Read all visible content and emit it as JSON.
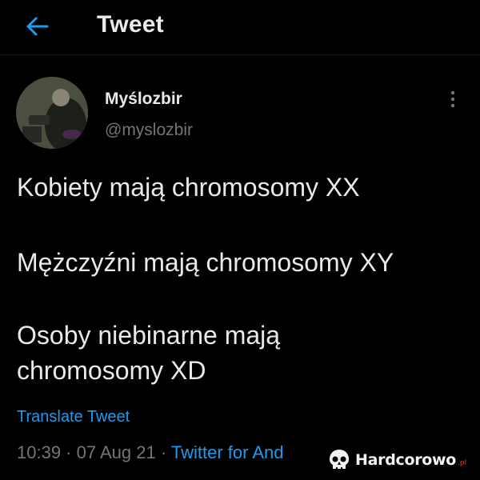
{
  "header": {
    "title": "Tweet",
    "back_icon": "arrow-left-icon"
  },
  "author": {
    "name": "Myślozbir",
    "handle": "@myslozbir"
  },
  "tweet": {
    "line1": "Kobiety mają chromosomy XX",
    "line2": "Mężczyźni mają chromosomy XY",
    "line3a": "Osoby niebinarne mają",
    "line3b": "chromosomy XD"
  },
  "actions": {
    "translate": "Translate Tweet"
  },
  "meta": {
    "time": "10:39",
    "sep1": " · ",
    "date": "07 Aug 21",
    "sep2": " · ",
    "source": "Twitter for And"
  },
  "watermark": {
    "brand": "Hardcorowo",
    "suffix": ".pl"
  },
  "colors": {
    "background": "#000000",
    "text": "#e7e9ea",
    "secondary": "#71767b",
    "accent": "#1d9bf0",
    "watermark_accent": "#e2412c"
  }
}
